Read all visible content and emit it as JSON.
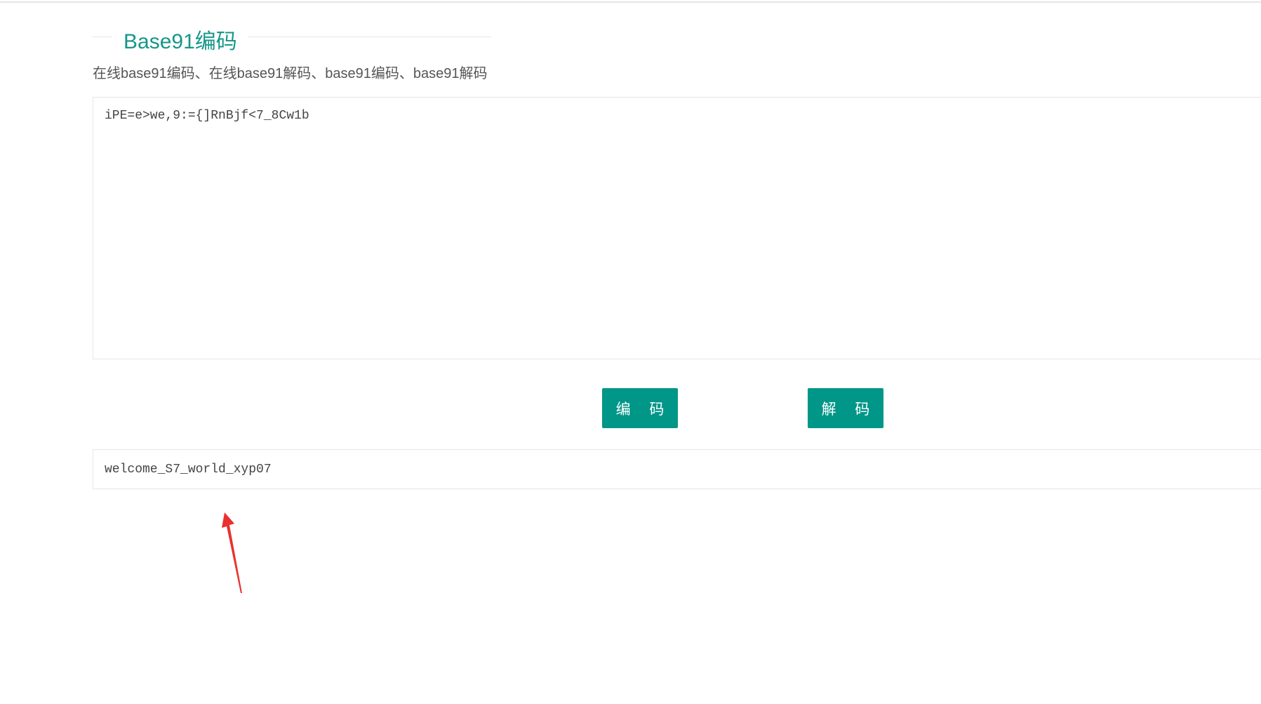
{
  "section": {
    "title": "Base91编码",
    "subtitle": "在线base91编码、在线base91解码、base91编码、base91解码"
  },
  "input": {
    "value": "iPE=e>we,9:={]RnBjf<7_8Cw1b"
  },
  "buttons": {
    "encode_label": "编 码",
    "decode_label": "解 码"
  },
  "output": {
    "value": "welcome_S7_world_xyp07"
  },
  "colors": {
    "accent": "#009688",
    "title": "#16968a",
    "annotation_arrow": "#e8322f"
  },
  "icons": {
    "annotation": "red-arrow-up"
  }
}
